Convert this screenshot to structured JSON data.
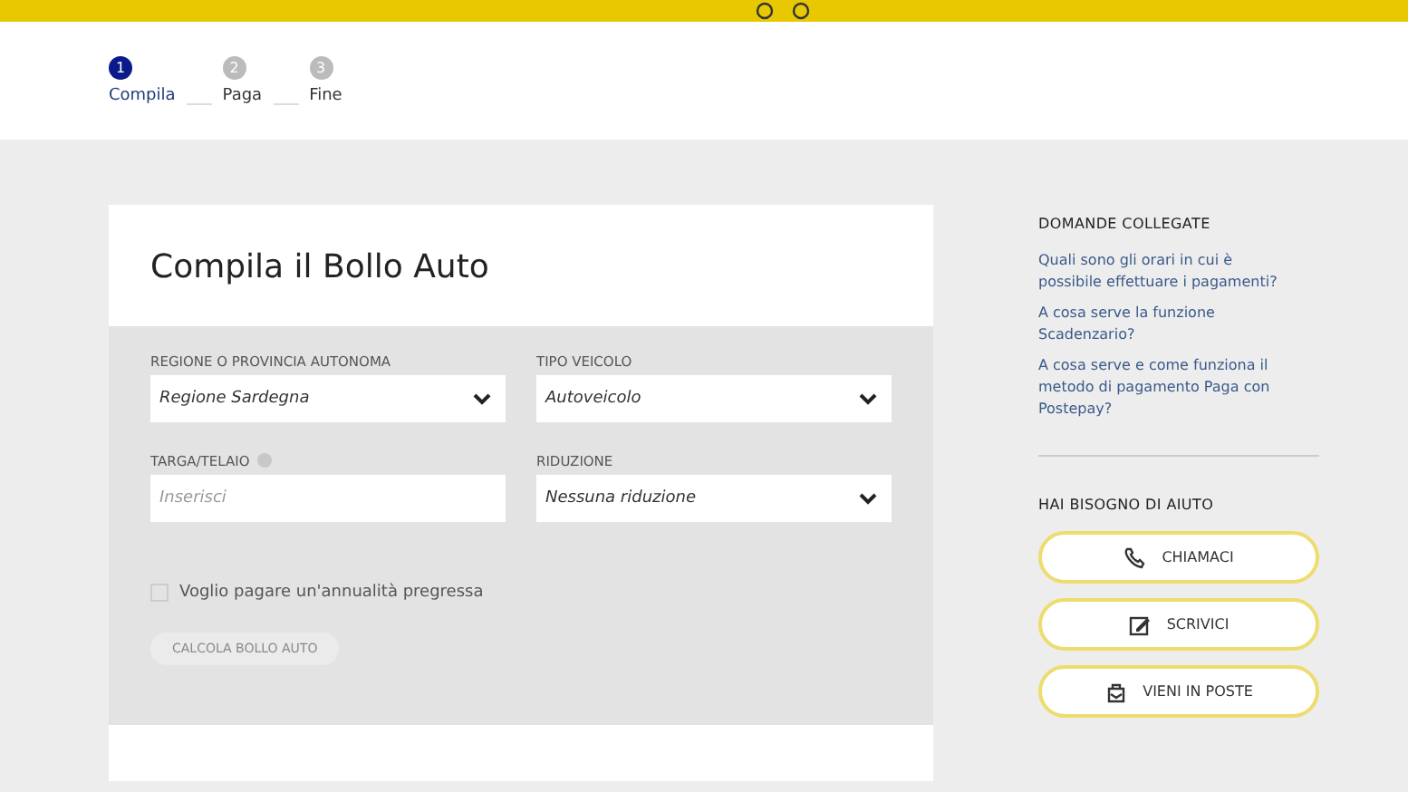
{
  "steps": [
    {
      "number": "1",
      "label": "Compila",
      "selected": true
    },
    {
      "number": "2",
      "label": "Paga",
      "selected": false
    },
    {
      "number": "3",
      "label": "Fine",
      "selected": false
    }
  ],
  "form": {
    "title": "Compila il Bollo Auto",
    "fields": [
      {
        "kind": "select",
        "label": "REGIONE O PROVINCIA AUTONOMA",
        "value": "Regione Sardegna",
        "info": false
      },
      {
        "kind": "select",
        "label": "TIPO VEICOLO",
        "value": "Autoveicolo",
        "info": false
      },
      {
        "kind": "text",
        "label": "TARGA/TELAIO",
        "placeholder": "Inserisci",
        "info": true
      },
      {
        "kind": "select",
        "label": "RIDUZIONE",
        "value": "Nessuna riduzione",
        "info": false
      }
    ],
    "checkbox": {
      "label": "Voglio pagare un'annualità pregressa",
      "checked": false
    },
    "submit": {
      "label": "CALCOLA BOLLO AUTO",
      "disabled": true
    }
  },
  "sidebar": {
    "related_title": "DOMANDE COLLEGATE",
    "links": [
      "Quali sono gli orari in cui è possibile effettuare i pagamenti?",
      "A cosa serve la funzione Scadenzario?",
      "A cosa serve e come funziona il metodo di pagamento Paga con Postepay?"
    ],
    "help_title": "HAI BISOGNO DI AIUTO",
    "help_buttons": [
      {
        "kind": "phone",
        "label": "CHIAMACI"
      },
      {
        "kind": "write",
        "label": "SCRIVICI"
      },
      {
        "kind": "office",
        "label": "VIENI IN POSTE"
      }
    ]
  }
}
